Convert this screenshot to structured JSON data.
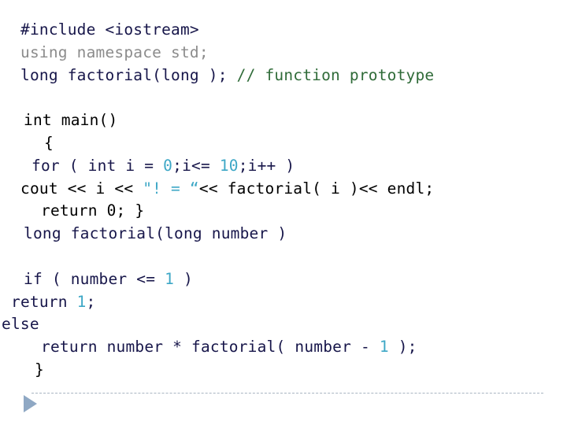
{
  "slide": {
    "title": "C++ factorial program code listing",
    "background_color": "#ffffff",
    "colors": {
      "dark_navy": "#17164a",
      "black": "#000000",
      "gray": "#8c8c8c",
      "green": "#2f6b38",
      "cyan": "#3da7c6",
      "divider": "#a9b4c2",
      "arrow": "#8fa8c4"
    }
  },
  "code": {
    "language": "cpp",
    "lines": [
      {
        "id": "line-1",
        "indent": 26,
        "tokens": [
          {
            "text": "#include <iostream>",
            "style": "dark"
          }
        ]
      },
      {
        "id": "line-2",
        "indent": 26,
        "tokens": [
          {
            "text": "using namespace std;",
            "style": "gray"
          }
        ]
      },
      {
        "id": "line-3",
        "indent": 26,
        "tokens": [
          {
            "text": "long factorial(long ); ",
            "style": "dark"
          },
          {
            "text": "// function prototype",
            "style": "green"
          }
        ]
      },
      {
        "id": "line-4",
        "indent": 26,
        "tokens": [
          {
            "text": " ",
            "style": "blank"
          }
        ]
      },
      {
        "id": "line-5",
        "indent": 30,
        "tokens": [
          {
            "text": "int main()",
            "style": "black"
          }
        ]
      },
      {
        "id": "line-6",
        "indent": 56,
        "tokens": [
          {
            "text": "{",
            "style": "black"
          }
        ]
      },
      {
        "id": "line-7",
        "indent": 40,
        "tokens": [
          {
            "text": "for ( int i = ",
            "style": "dark"
          },
          {
            "text": "0",
            "style": "cyan"
          },
          {
            "text": ";i<= ",
            "style": "dark"
          },
          {
            "text": "10",
            "style": "cyan"
          },
          {
            "text": ";i++ )",
            "style": "dark"
          }
        ]
      },
      {
        "id": "line-8",
        "indent": 26,
        "tokens": [
          {
            "text": "cout << i << ",
            "style": "black"
          },
          {
            "text": "\"! = “",
            "style": "cyan"
          },
          {
            "text": "<< factorial( i )<< endl;",
            "style": "black"
          }
        ]
      },
      {
        "id": "line-9",
        "indent": 52,
        "tokens": [
          {
            "text": "return 0; }",
            "style": "black"
          }
        ]
      },
      {
        "id": "line-10",
        "indent": 30,
        "tokens": [
          {
            "text": "long factorial(long number )",
            "style": "dark"
          }
        ]
      },
      {
        "id": "line-11",
        "indent": 26,
        "tokens": [
          {
            "text": " ",
            "style": "blank"
          }
        ]
      },
      {
        "id": "line-12",
        "indent": 30,
        "tokens": [
          {
            "text": "if ( number <= ",
            "style": "dark"
          },
          {
            "text": "1",
            "style": "cyan"
          },
          {
            "text": " )",
            "style": "dark"
          }
        ]
      },
      {
        "id": "line-13",
        "indent": 14,
        "tokens": [
          {
            "text": "return ",
            "style": "dark"
          },
          {
            "text": "1",
            "style": "cyan"
          },
          {
            "text": ";",
            "style": "dark"
          }
        ]
      },
      {
        "id": "line-14",
        "indent": 2,
        "tokens": [
          {
            "text": "else",
            "style": "dark"
          }
        ]
      },
      {
        "id": "line-15",
        "indent": 52,
        "tokens": [
          {
            "text": "return number * factorial( number - ",
            "style": "dark"
          },
          {
            "text": "1",
            "style": "cyan"
          },
          {
            "text": " );",
            "style": "dark"
          }
        ]
      },
      {
        "id": "line-16",
        "indent": 44,
        "tokens": [
          {
            "text": "}",
            "style": "black"
          }
        ]
      }
    ]
  },
  "footer": {
    "divider_label": "dashed-divider",
    "arrow_label": "play-arrow"
  }
}
